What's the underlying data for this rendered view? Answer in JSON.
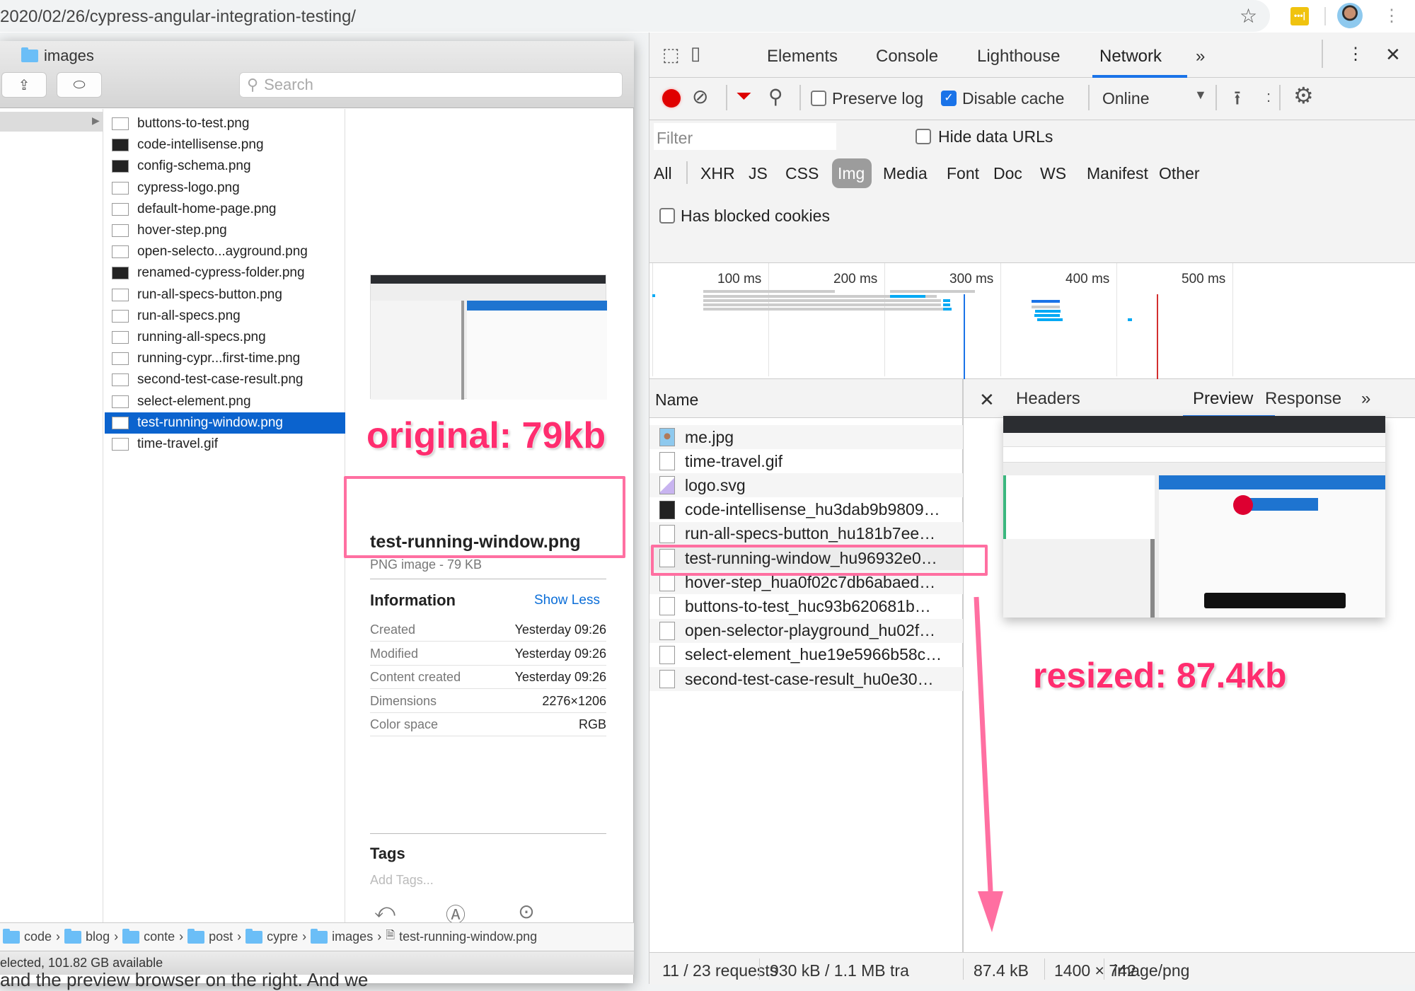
{
  "browser": {
    "url": "2020/02/26/cypress-angular-integration-testing/",
    "extension_label": "•••|"
  },
  "finder": {
    "title": "images",
    "search_placeholder": "Search",
    "files": [
      {
        "name": "buttons-to-test.png",
        "thumb": "light"
      },
      {
        "name": "code-intellisense.png",
        "thumb": "dark"
      },
      {
        "name": "config-schema.png",
        "thumb": "dark"
      },
      {
        "name": "cypress-logo.png",
        "thumb": "light"
      },
      {
        "name": "default-home-page.png",
        "thumb": "light"
      },
      {
        "name": "hover-step.png",
        "thumb": "light"
      },
      {
        "name": "open-selecto...ayground.png",
        "thumb": "light"
      },
      {
        "name": "renamed-cypress-folder.png",
        "thumb": "dark"
      },
      {
        "name": "run-all-specs-button.png",
        "thumb": "light"
      },
      {
        "name": "run-all-specs.png",
        "thumb": "light"
      },
      {
        "name": "running-all-specs.png",
        "thumb": "light"
      },
      {
        "name": "running-cypr...first-time.png",
        "thumb": "light"
      },
      {
        "name": "second-test-case-result.png",
        "thumb": "light"
      },
      {
        "name": "select-element.png",
        "thumb": "light"
      },
      {
        "name": "test-running-window.png",
        "thumb": "light",
        "selected": true
      },
      {
        "name": "time-travel.gif",
        "thumb": "light"
      }
    ],
    "preview": {
      "file_name": "test-running-window.png",
      "file_kind": "PNG image - 79 KB",
      "info_title": "Information",
      "show_less": "Show Less",
      "info": [
        {
          "key": "Created",
          "value": "Yesterday 09:26"
        },
        {
          "key": "Modified",
          "value": "Yesterday 09:26"
        },
        {
          "key": "Content created",
          "value": "Yesterday 09:26"
        },
        {
          "key": "Dimensions",
          "value": "2276×1206"
        },
        {
          "key": "Color space",
          "value": "RGB"
        }
      ],
      "tags_title": "Tags",
      "tags_placeholder": "Add Tags...",
      "actions": [
        {
          "label": "Rotate Left",
          "icon": "rotate-left-icon"
        },
        {
          "label": "Markup",
          "icon": "markup-icon"
        },
        {
          "label": "More...",
          "icon": "more-icon"
        }
      ]
    },
    "path": [
      "code",
      "blog",
      "conte",
      "post",
      "cypre",
      "images",
      "test-running-window.png"
    ],
    "status": "elected, 101.82 GB available"
  },
  "background_text": "and the preview browser on the right. And we",
  "devtools": {
    "tabs": [
      "Elements",
      "Console",
      "Lighthouse",
      "Network"
    ],
    "active_tab": "Network",
    "more_tabs": "»",
    "toolbar": {
      "preserve_log": {
        "label": "Preserve log",
        "checked": false
      },
      "disable_cache": {
        "label": "Disable cache",
        "checked": true
      },
      "throttle": "Online"
    },
    "filter_placeholder": "Filter",
    "hide_data_urls": {
      "label": "Hide data URLs",
      "checked": false
    },
    "type_filters": [
      "All",
      "XHR",
      "JS",
      "CSS",
      "Img",
      "Media",
      "Font",
      "Doc",
      "WS",
      "Manifest",
      "Other"
    ],
    "active_type": "Img",
    "has_blocked_cookies": {
      "label": "Has blocked cookies",
      "checked": false
    },
    "timeline": {
      "ticks": [
        "100 ms",
        "200 ms",
        "300 ms",
        "400 ms",
        "500 ms"
      ],
      "dom_content_loaded_ms": 268,
      "load_ms": 435
    },
    "name_header": "Name",
    "requests": [
      {
        "name": "me.jpg",
        "thumb": "photo"
      },
      {
        "name": "time-travel.gif",
        "thumb": "light"
      },
      {
        "name": "logo.svg",
        "thumb": "purple"
      },
      {
        "name": "code-intellisense_hu3dab9b9809…",
        "thumb": "dark"
      },
      {
        "name": "run-all-specs-button_hu181b7ee…",
        "thumb": "light"
      },
      {
        "name": "test-running-window_hu96932e0…",
        "thumb": "light",
        "selected": true
      },
      {
        "name": "hover-step_hua0f02c7db6abaed…",
        "thumb": "light"
      },
      {
        "name": "buttons-to-test_huc93b620681b…",
        "thumb": "light"
      },
      {
        "name": "open-selector-playground_hu02f…",
        "thumb": "light"
      },
      {
        "name": "select-element_hue19e5966b58c…",
        "thumb": "light"
      },
      {
        "name": "second-test-case-result_hu0e30…",
        "thumb": "light"
      }
    ],
    "detail_tabs": [
      "Headers",
      "Preview",
      "Response"
    ],
    "active_detail_tab": "Preview",
    "status": {
      "requests": "11 / 23 requests",
      "transferred": "930 kB / 1.1 MB tra",
      "size": "87.4 kB",
      "dimensions": "1400 × 742",
      "mime": "image/png"
    }
  },
  "annotations": {
    "original": "original: 79kb",
    "resized": "resized: 87.4kb"
  },
  "colors": {
    "accent": "#1a73e8",
    "finder_selection": "#0b63ce",
    "annotation": "#ff2d6f",
    "record": "#e00000"
  }
}
